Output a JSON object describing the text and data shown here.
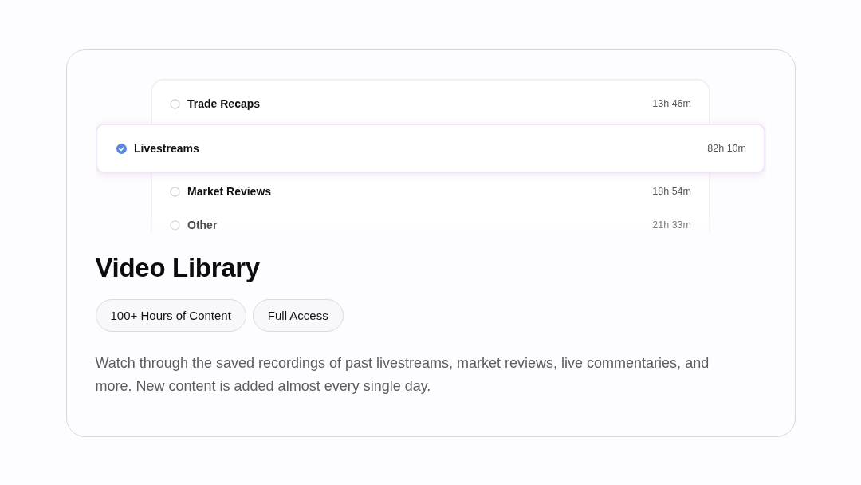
{
  "categories": [
    {
      "label": "Trade Recaps",
      "duration": "13h 46m",
      "selected": false
    },
    {
      "label": "Livestreams",
      "duration": "82h 10m",
      "selected": true
    },
    {
      "label": "Market Reviews",
      "duration": "18h 54m",
      "selected": false
    },
    {
      "label": "Other",
      "duration": "21h 33m",
      "selected": false
    }
  ],
  "title": "Video Library",
  "tags": [
    "100+ Hours of Content",
    "Full Access"
  ],
  "description": "Watch through the saved recordings of past livestreams, market reviews, live commentaries, and more. New content is added almost every single day."
}
